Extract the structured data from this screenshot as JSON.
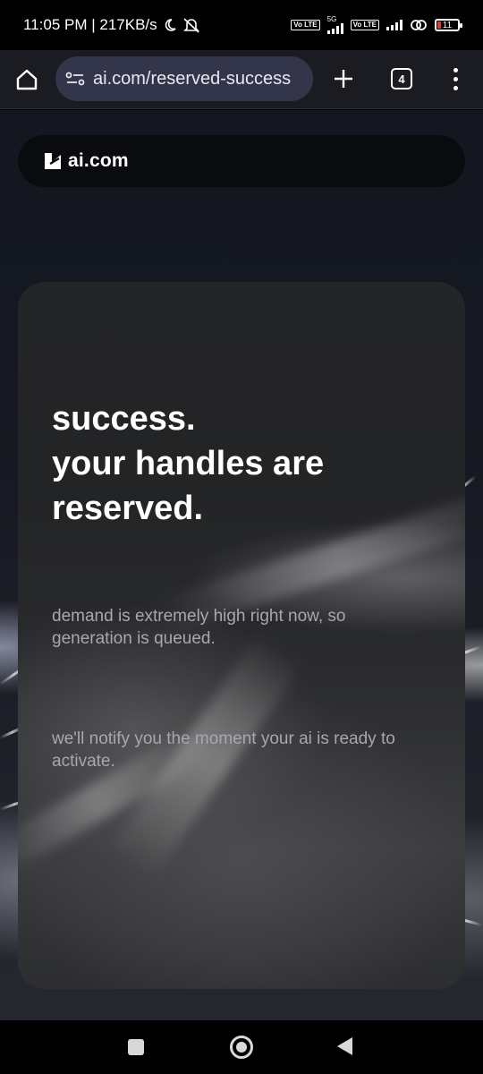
{
  "status_bar": {
    "time_speed": "11:05 PM | 217KB/s",
    "network_5g": "5G",
    "volte": "Vo LTE",
    "battery": "11"
  },
  "browser": {
    "url": "ai.com/reserved-success",
    "tab_count": "4"
  },
  "site": {
    "logo_text": "ai.com"
  },
  "card": {
    "headline_lines": [
      "success.",
      "your handles are",
      "reserved."
    ],
    "paragraph_1": "demand is extremely high right now, so generation is queued.",
    "paragraph_2": "we'll notify you the moment your ai is ready to activate."
  },
  "colors": {
    "browser_bar": "#1b1c22",
    "url_box": "#33354a",
    "logo_bar": "#0a0b0f",
    "card_text_muted": "#a7a8ad"
  }
}
